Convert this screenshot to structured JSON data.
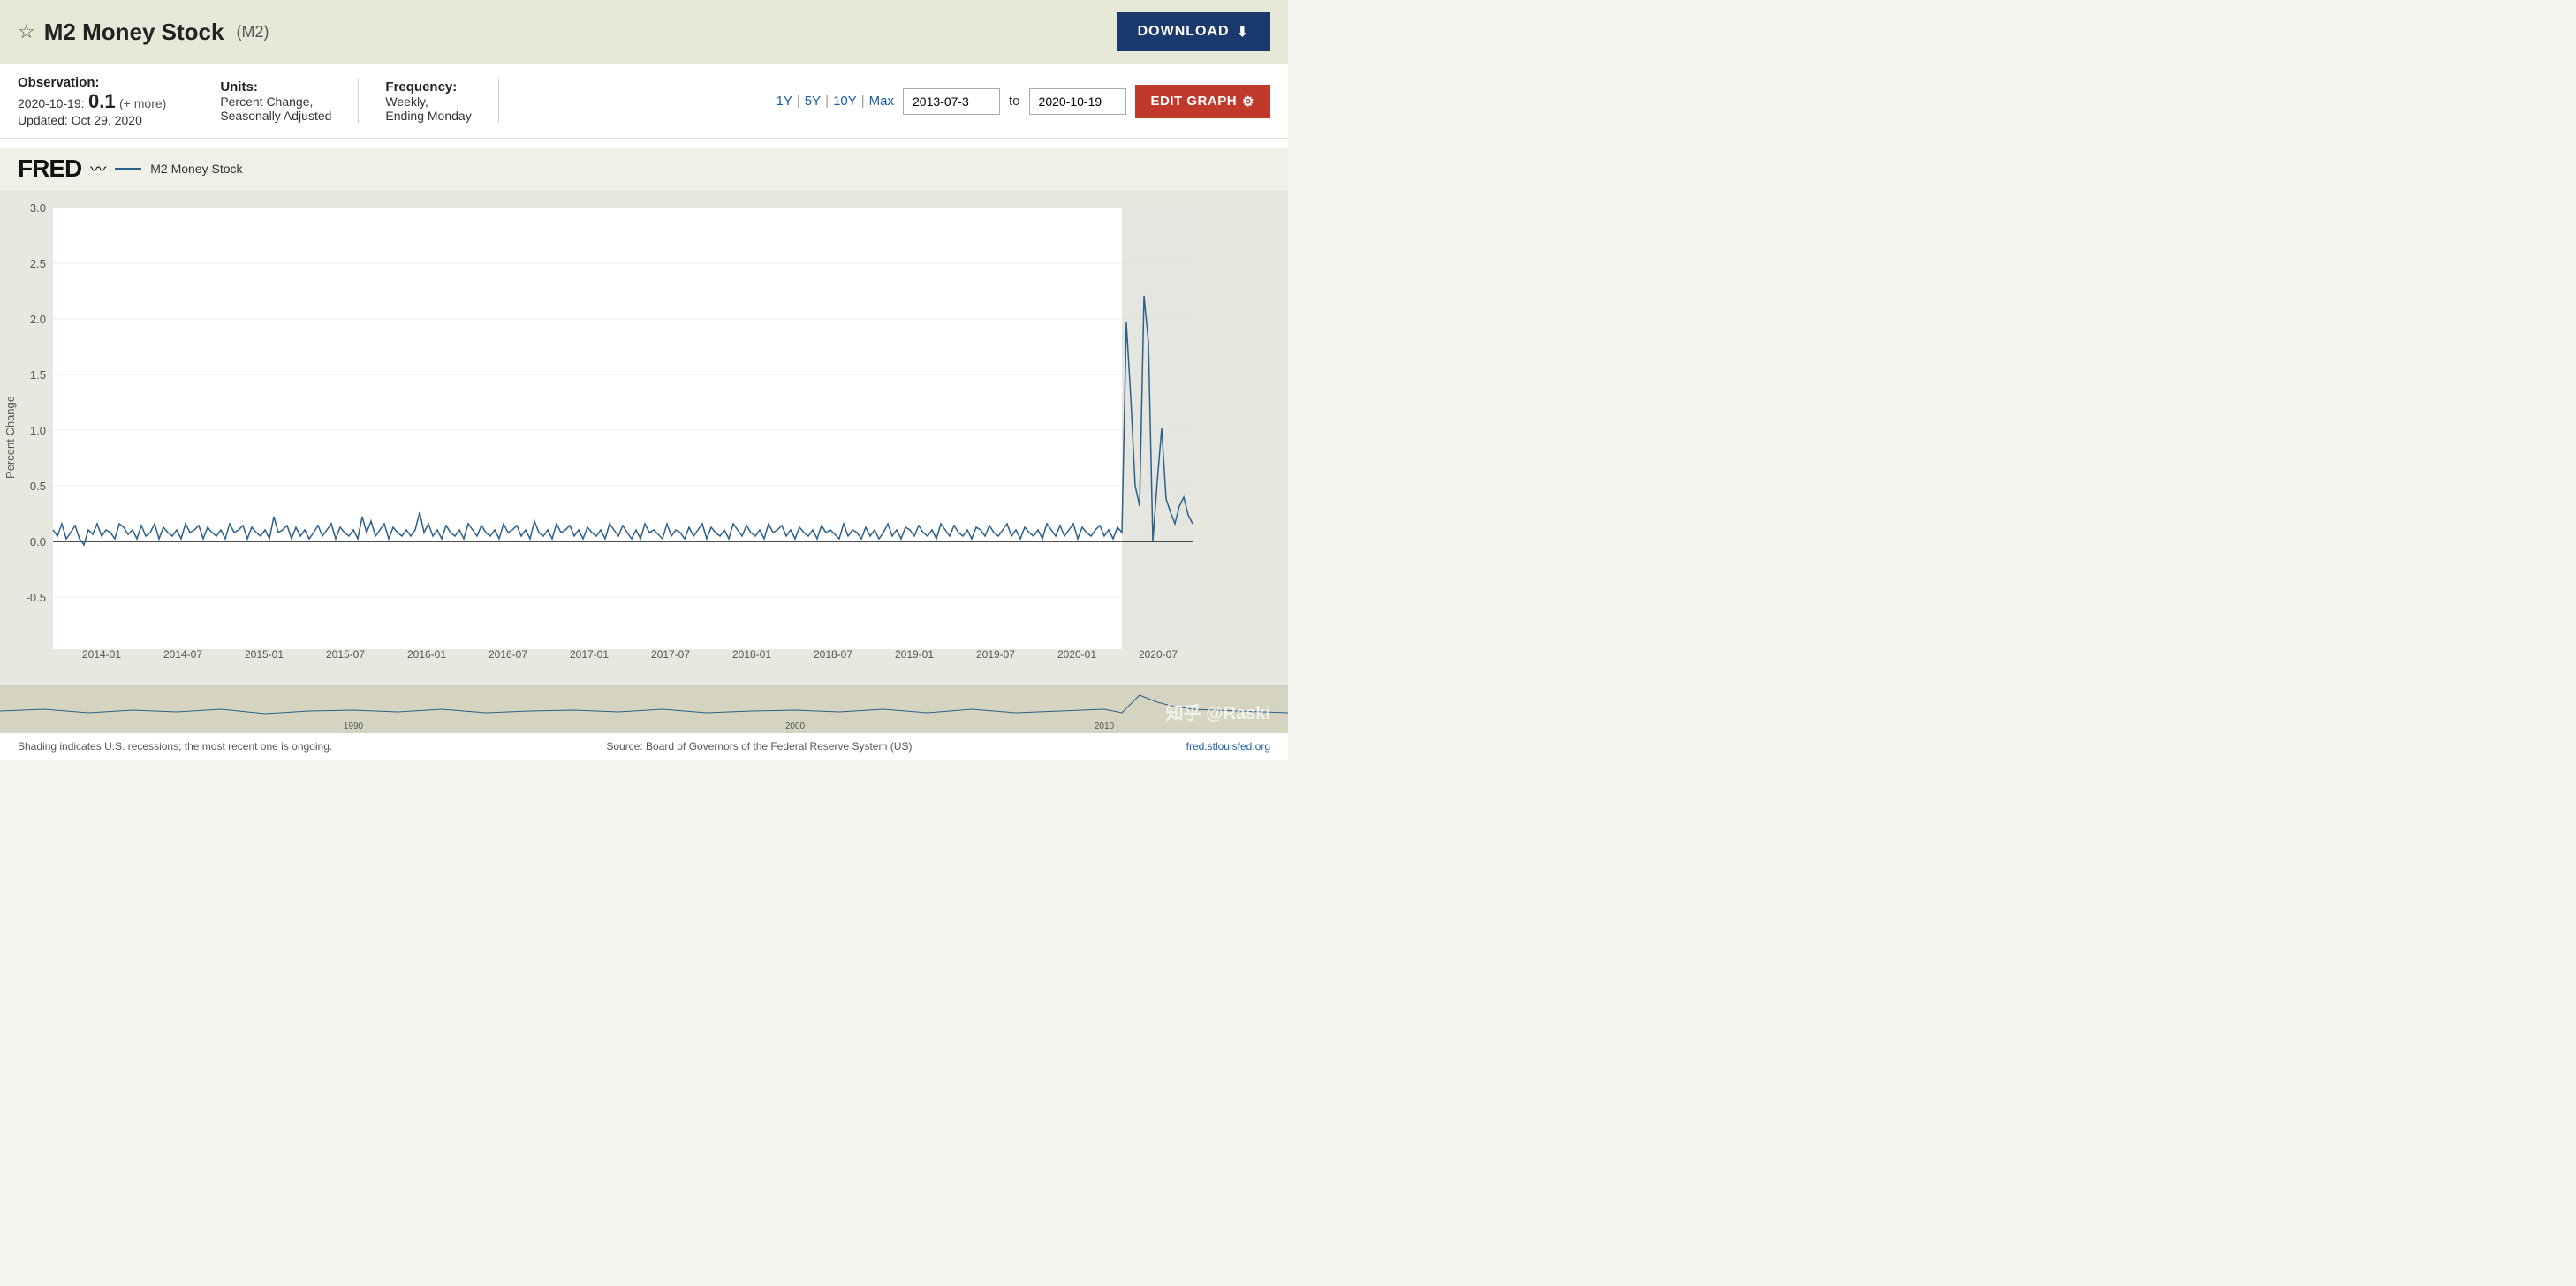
{
  "header": {
    "title": "M2 Money Stock",
    "ticker": "(M2)",
    "download_label": "DOWNLOAD",
    "star_icon": "☆"
  },
  "info": {
    "observation_label": "Observation:",
    "observation_date": "2020-10-19:",
    "observation_value": "0.1",
    "observation_more": "(+ more)",
    "updated_label": "Updated:",
    "updated_value": "Oct 29, 2020",
    "units_label": "Units:",
    "units_value": "Percent Change,\nSeasonally Adjusted",
    "frequency_label": "Frequency:",
    "frequency_value": "Weekly,\nEnding Monday"
  },
  "range_controls": {
    "ranges": [
      "1Y",
      "5Y",
      "10Y",
      "Max"
    ],
    "date_from": "2013-07-3",
    "date_to": "2020-10-19",
    "to_label": "to",
    "edit_label": "EDIT GRAPH"
  },
  "chart": {
    "y_axis_label": "Percent Change",
    "y_ticks": [
      "3.0",
      "2.5",
      "2.0",
      "1.5",
      "1.0",
      "0.5",
      "0.0",
      "-0.5"
    ],
    "x_ticks": [
      "2014-01",
      "2014-07",
      "2015-01",
      "2015-07",
      "2016-01",
      "2016-07",
      "2017-01",
      "2017-07",
      "2018-01",
      "2018-07",
      "2019-01",
      "2019-07",
      "2020-01",
      "2020-07"
    ],
    "legend_name": "M2 Money Stock",
    "fred_logo": "FRED",
    "shaded_region_note": "Shading indicates U.S. recessions; the most recent one is ongoing.",
    "source_note": "Source: Board of Governors of the Federal Reserve System (US)",
    "fred_url": "fred.stlouisfed.org"
  },
  "watermark": "知乎 @Raski"
}
